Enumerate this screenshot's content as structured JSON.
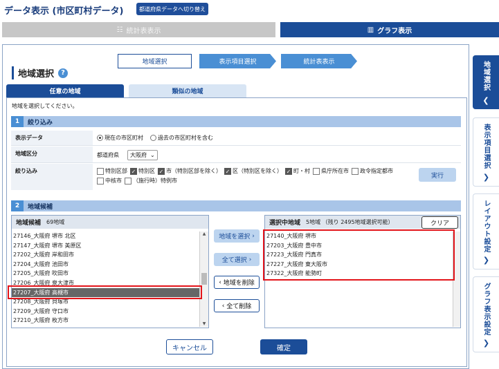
{
  "header": {
    "title": "データ表示 (市区町村データ)",
    "switch_button": "都道府県データへ切り替え"
  },
  "top_tabs": {
    "stats": "統計表表示",
    "graph": "グラフ表示"
  },
  "steps": [
    "地域選択",
    "表示項目選択",
    "統計表表示"
  ],
  "section_title": "地域選択",
  "sub_tabs": {
    "any": "任意の地域",
    "similar": "類似の地域"
  },
  "instruction": "地域を選択してください。",
  "filter": {
    "number": "1",
    "title": "絞り込み",
    "display_data": {
      "label": "表示データ",
      "opt_current": "現在の市区町村",
      "opt_past": "過去の市区町村を含む"
    },
    "region": {
      "label": "地域区分",
      "pref_label": "都道府県",
      "pref_value": "大阪府"
    },
    "narrow": {
      "label": "絞り込み",
      "options": [
        {
          "label": "特別区部",
          "checked": false
        },
        {
          "label": "特別区",
          "checked": true
        },
        {
          "label": "市（特別区部を除く）",
          "checked": true
        },
        {
          "label": "区（特別区を除く）",
          "checked": true
        },
        {
          "label": "町・村",
          "checked": true
        },
        {
          "label": "県庁所在市",
          "checked": false
        },
        {
          "label": "政令指定都市",
          "checked": false
        },
        {
          "label": "中核市",
          "checked": false
        },
        {
          "label": "（施行時）特例市",
          "checked": false
        }
      ],
      "run": "実行"
    }
  },
  "candidates": {
    "number": "2",
    "title": "地域候補",
    "box_title": "地域候補",
    "count": "69地域",
    "items": [
      "27146_大阪府 堺市 北区",
      "27147_大阪府 堺市 美原区",
      "27202_大阪府 岸和田市",
      "27204_大阪府 池田市",
      "27205_大阪府 吹田市",
      "27206_大阪府 泉大津市",
      "27207_大阪府 高槻市",
      "27208_大阪府 貝塚市",
      "27209_大阪府 守口市",
      "27210_大阪府 枚方市"
    ],
    "highlighted_index": 6
  },
  "buttons": {
    "add": "地域を選択",
    "add_all": "全て選択",
    "remove": "地域を削除",
    "remove_all": "全て削除"
  },
  "selected": {
    "box_title": "選択中地域",
    "count": "5地域 （残り 2495地域選択可能）",
    "clear": "クリア",
    "items": [
      "27140_大阪府 堺市",
      "27203_大阪府 豊中市",
      "27223_大阪府 門真市",
      "27227_大阪府 東大阪市",
      "27322_大阪府 能勢町"
    ]
  },
  "footer": {
    "cancel": "キャンセル",
    "confirm": "確定"
  },
  "side_tabs": [
    "地域選択",
    "表示項目選択",
    "レイアウト設定",
    "グラフ表示設定"
  ]
}
